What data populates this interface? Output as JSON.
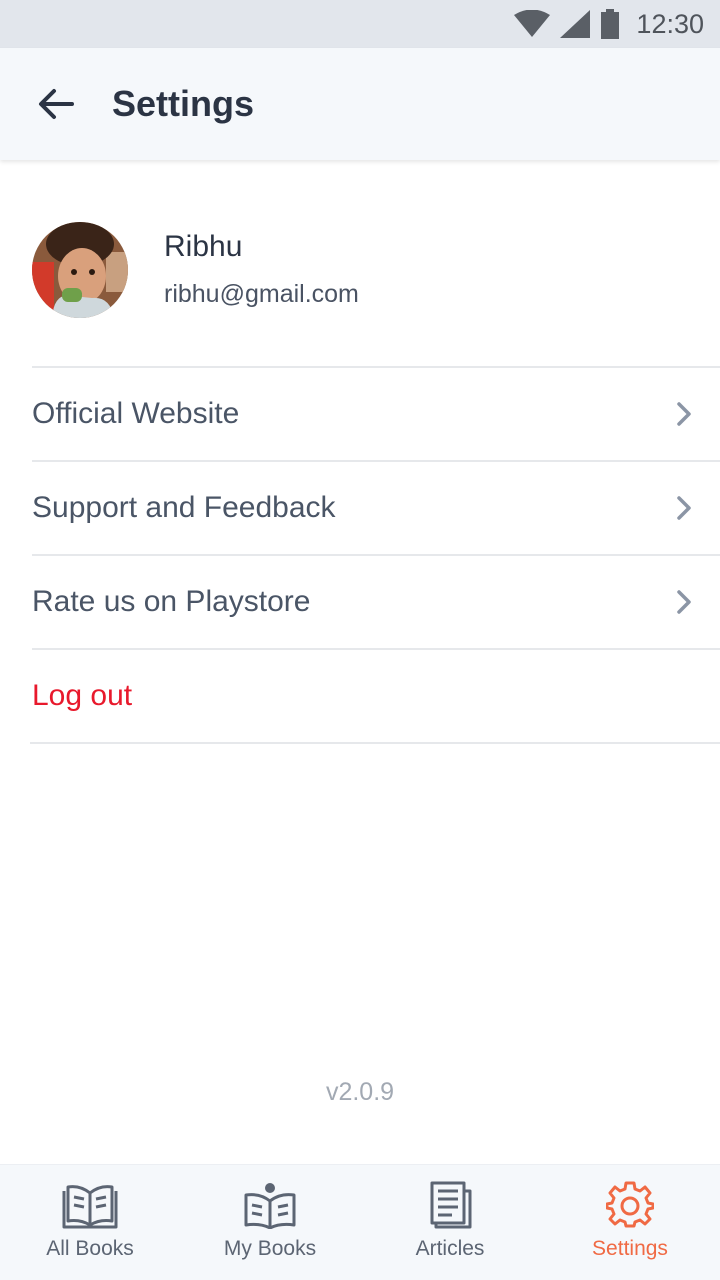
{
  "status_bar": {
    "time": "12:30"
  },
  "header": {
    "title": "Settings"
  },
  "profile": {
    "name": "Ribhu",
    "email": "ribhu@gmail.com"
  },
  "menu": {
    "items": [
      {
        "label": "Official Website"
      },
      {
        "label": "Support and Feedback"
      },
      {
        "label": "Rate us on Playstore"
      }
    ],
    "logout_label": "Log out"
  },
  "version": "v2.0.9",
  "bottom_nav": {
    "items": [
      {
        "label": "All Books",
        "icon": "open-book-icon"
      },
      {
        "label": "My Books",
        "icon": "reader-icon"
      },
      {
        "label": "Articles",
        "icon": "article-icon"
      },
      {
        "label": "Settings",
        "icon": "gear-icon",
        "active": true
      }
    ]
  },
  "colors": {
    "accent": "#f06a44",
    "danger": "#e8192c",
    "text": "#2b3444",
    "nav_bg": "#f5f8fb"
  }
}
